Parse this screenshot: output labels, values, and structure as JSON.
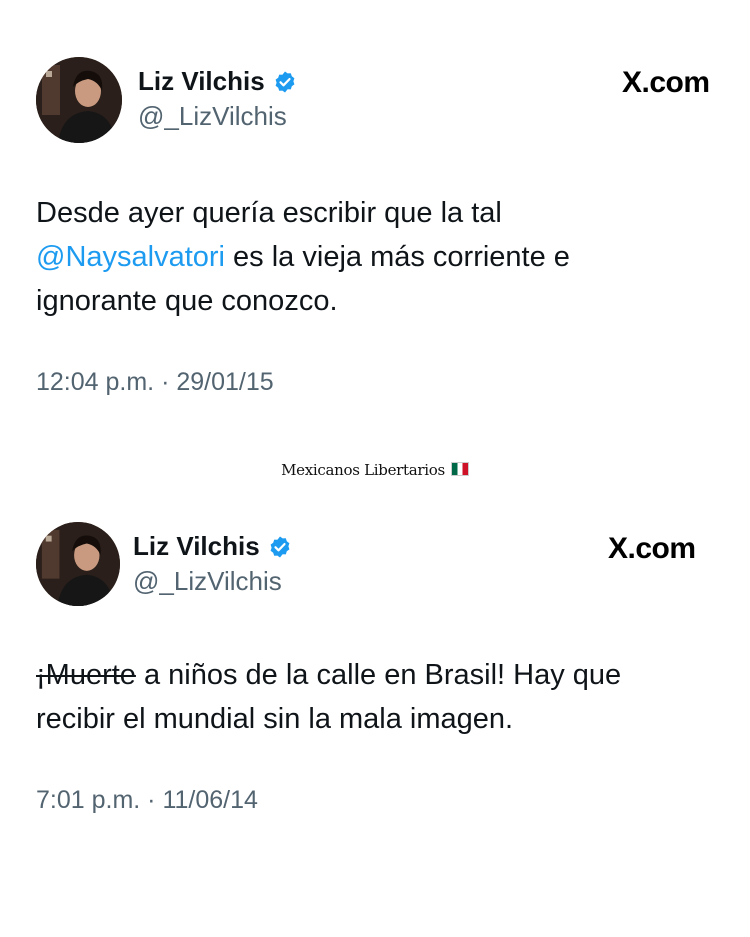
{
  "watermark": {
    "text": "Mexicanos Libertarios"
  },
  "tweets": [
    {
      "author": {
        "display_name": "Liz Vilchis",
        "handle": "@_LizVilchis",
        "verified": true,
        "avatar_icon": "profile-photo"
      },
      "source": "X.com",
      "body": {
        "line1": "Desde ayer quería escribir que la tal",
        "mention": "@Naysalvatori",
        "line2_rest": " es la vieja más corriente e",
        "line3": "ignorante que conozco."
      },
      "timestamp": "12:04 p.m. · 29/01/15"
    },
    {
      "author": {
        "display_name": "Liz Vilchis",
        "handle": "@_LizVilchis",
        "verified": true,
        "avatar_icon": "profile-photo"
      },
      "source": "X.com",
      "body": {
        "struck": "¡Muerte",
        "line1_rest": " a niños de la calle en Brasil! Hay que",
        "line2": "recibir el mundial sin la mala imagen."
      },
      "timestamp": "7:01 p.m. · 11/06/14"
    }
  ],
  "colors": {
    "text": "#0f1419",
    "secondary": "#536471",
    "mention": "#1d9bf0",
    "verified": "#1d9bf0"
  }
}
